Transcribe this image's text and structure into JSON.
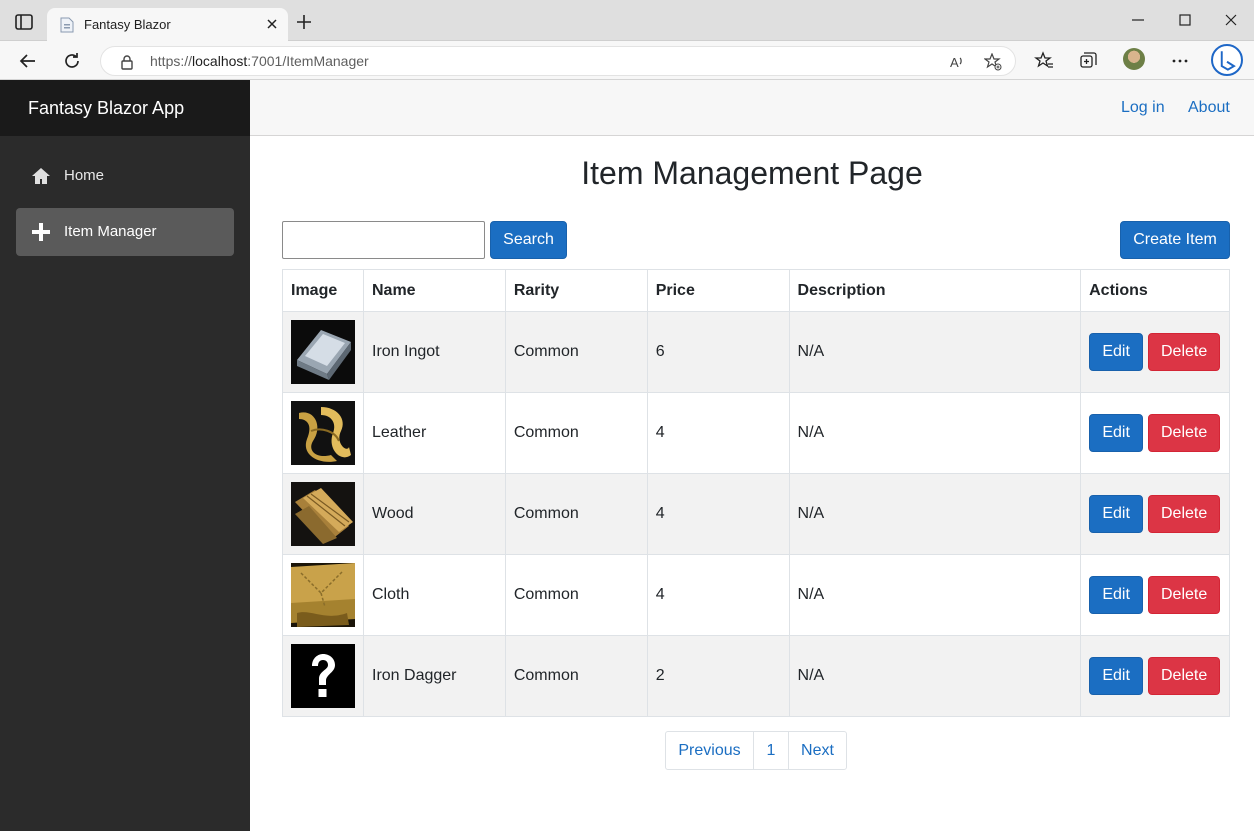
{
  "browser": {
    "tab_title": "Fantasy Blazor",
    "url_scheme": "https://",
    "url_host": "localhost",
    "url_path": ":7001/ItemManager"
  },
  "app": {
    "brand": "Fantasy Blazor App",
    "nav": [
      {
        "label": "Home",
        "icon": "home-icon",
        "active": false
      },
      {
        "label": "Item Manager",
        "icon": "plus-icon",
        "active": true
      }
    ],
    "top_links": {
      "login": "Log in",
      "about": "About"
    }
  },
  "page": {
    "title": "Item Management Page",
    "search_value": "",
    "search_button": "Search",
    "create_button": "Create Item"
  },
  "table": {
    "headers": [
      "Image",
      "Name",
      "Rarity",
      "Price",
      "Description",
      "Actions"
    ],
    "rows": [
      {
        "image": "iron-ingot-image",
        "name": "Iron Ingot",
        "rarity": "Common",
        "price": "6",
        "description": "N/A"
      },
      {
        "image": "leather-image",
        "name": "Leather",
        "rarity": "Common",
        "price": "4",
        "description": "N/A"
      },
      {
        "image": "wood-image",
        "name": "Wood",
        "rarity": "Common",
        "price": "4",
        "description": "N/A"
      },
      {
        "image": "cloth-image",
        "name": "Cloth",
        "rarity": "Common",
        "price": "4",
        "description": "N/A"
      },
      {
        "image": "unknown-item-image",
        "name": "Iron Dagger",
        "rarity": "Common",
        "price": "2",
        "description": "N/A"
      }
    ],
    "edit_label": "Edit",
    "delete_label": "Delete"
  },
  "pagination": {
    "previous": "Previous",
    "current": "1",
    "next": "Next"
  },
  "colors": {
    "primary": "#1b6ec2",
    "danger": "#dc3545",
    "sidebar": "#2b2b2b",
    "brand_bar": "#1a1a1a"
  }
}
